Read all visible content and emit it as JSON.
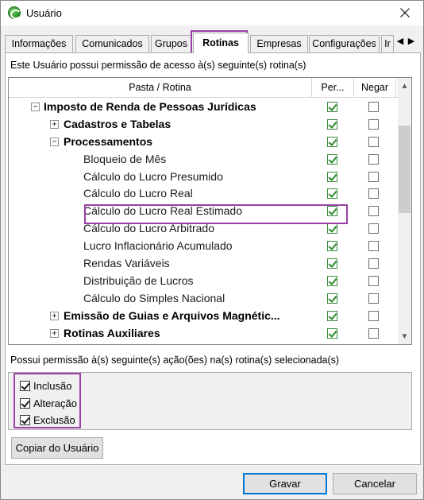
{
  "window": {
    "title": "Usuário"
  },
  "tabs": [
    "Informações",
    "Comunicados",
    "Grupos",
    "Rotinas",
    "Empresas",
    "Configurações",
    "Ir"
  ],
  "active_tab": "Rotinas",
  "access_label": "Este Usuário possui permissão de acesso à(s) seguinte(s) rotina(s)",
  "grid": {
    "headers": {
      "routine": "Pasta / Rotina",
      "permit": "Per...",
      "deny": "Negar"
    },
    "rows": [
      {
        "label": "Imposto de Renda de Pessoas Jurídicas",
        "level": 1,
        "expander": "−",
        "bold": true,
        "permit": true,
        "deny": false
      },
      {
        "label": "Cadastros e Tabelas",
        "level": 2,
        "expander": "+",
        "bold": true,
        "permit": true,
        "deny": false
      },
      {
        "label": "Processamentos",
        "level": 2,
        "expander": "−",
        "bold": true,
        "permit": true,
        "deny": false
      },
      {
        "label": "Bloqueio de Mês",
        "level": 3,
        "expander": "",
        "bold": false,
        "permit": true,
        "deny": false
      },
      {
        "label": "Cálculo do Lucro Presumido",
        "level": 3,
        "expander": "",
        "bold": false,
        "permit": true,
        "deny": false
      },
      {
        "label": "Cálculo do Lucro Real",
        "level": 3,
        "expander": "",
        "bold": false,
        "permit": true,
        "deny": false
      },
      {
        "label": "Cálculo do Lucro Real Estimado",
        "level": 3,
        "expander": "",
        "bold": false,
        "permit": true,
        "deny": false
      },
      {
        "label": "Cálculo do Lucro Arbitrado",
        "level": 3,
        "expander": "",
        "bold": false,
        "permit": true,
        "deny": false
      },
      {
        "label": "Lucro Inflacionário Acumulado",
        "level": 3,
        "expander": "",
        "bold": false,
        "permit": true,
        "deny": false
      },
      {
        "label": "Rendas Variáveis",
        "level": 3,
        "expander": "",
        "bold": false,
        "permit": true,
        "deny": false
      },
      {
        "label": "Distribuição de Lucros",
        "level": 3,
        "expander": "",
        "bold": false,
        "permit": true,
        "deny": false
      },
      {
        "label": "Cálculo do Simples Nacional",
        "level": 3,
        "expander": "",
        "bold": false,
        "permit": true,
        "deny": false
      },
      {
        "label": "Emissão de Guias e Arquivos Magnétic...",
        "level": 2,
        "expander": "+",
        "bold": true,
        "permit": true,
        "deny": false
      },
      {
        "label": "Rotinas Auxiliares",
        "level": 2,
        "expander": "+",
        "bold": true,
        "permit": true,
        "deny": false
      }
    ],
    "highlighted_row": "Cálculo do Lucro Real Estimado"
  },
  "actions_label": "Possui permissão à(s) seguinte(s) ação(ões) na(s) rotina(s) selecionada(s)",
  "actions": [
    {
      "label": "Inclusão",
      "checked": true
    },
    {
      "label": "Alteração",
      "checked": true
    },
    {
      "label": "Exclusão",
      "checked": true
    }
  ],
  "buttons": {
    "copy": "Copiar do Usuário",
    "save": "Gravar",
    "cancel": "Cancelar"
  },
  "colors": {
    "highlight": "#9a3fa6",
    "check_green": "#2a8a2a"
  }
}
